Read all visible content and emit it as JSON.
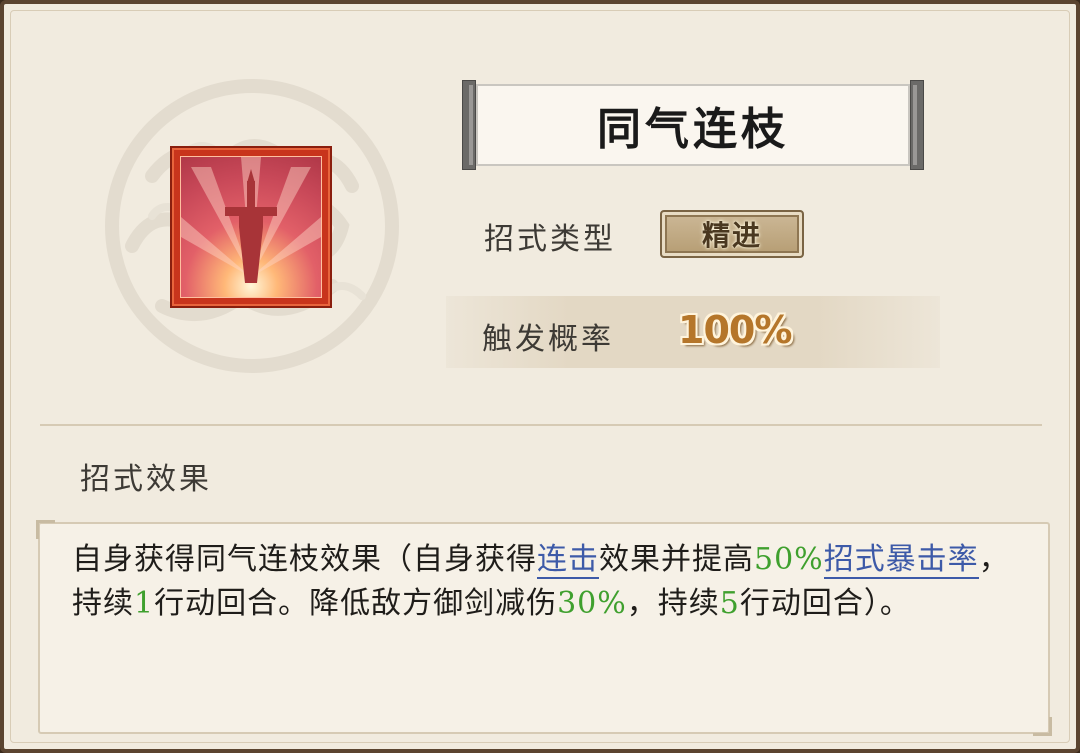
{
  "skill": {
    "name": "同气连枝",
    "icon": "sword-icon",
    "type_label": "招式类型",
    "type_value": "精进",
    "prob_label": "触发概率",
    "prob_value": "100%"
  },
  "effect": {
    "heading": "招式效果",
    "segments": [
      {
        "text": "自身获得同气连枝效果（自身获得",
        "style": "plain"
      },
      {
        "text": "连击",
        "style": "keyword"
      },
      {
        "text": "效果并提高",
        "style": "plain"
      },
      {
        "text": "50%",
        "style": "number"
      },
      {
        "text": "招式暴击率",
        "style": "keyword"
      },
      {
        "text": "，持续",
        "style": "plain"
      },
      {
        "text": "1",
        "style": "number"
      },
      {
        "text": "行动回合。降低敌方御剑减伤",
        "style": "plain"
      },
      {
        "text": "30%",
        "style": "number"
      },
      {
        "text": "，持续",
        "style": "plain"
      },
      {
        "text": "5",
        "style": "number"
      },
      {
        "text": "行动回合）。",
        "style": "plain"
      }
    ]
  },
  "colors": {
    "keyword": "#3d5aa8",
    "number": "#3fa02e",
    "prob_value": "#b5762a"
  }
}
